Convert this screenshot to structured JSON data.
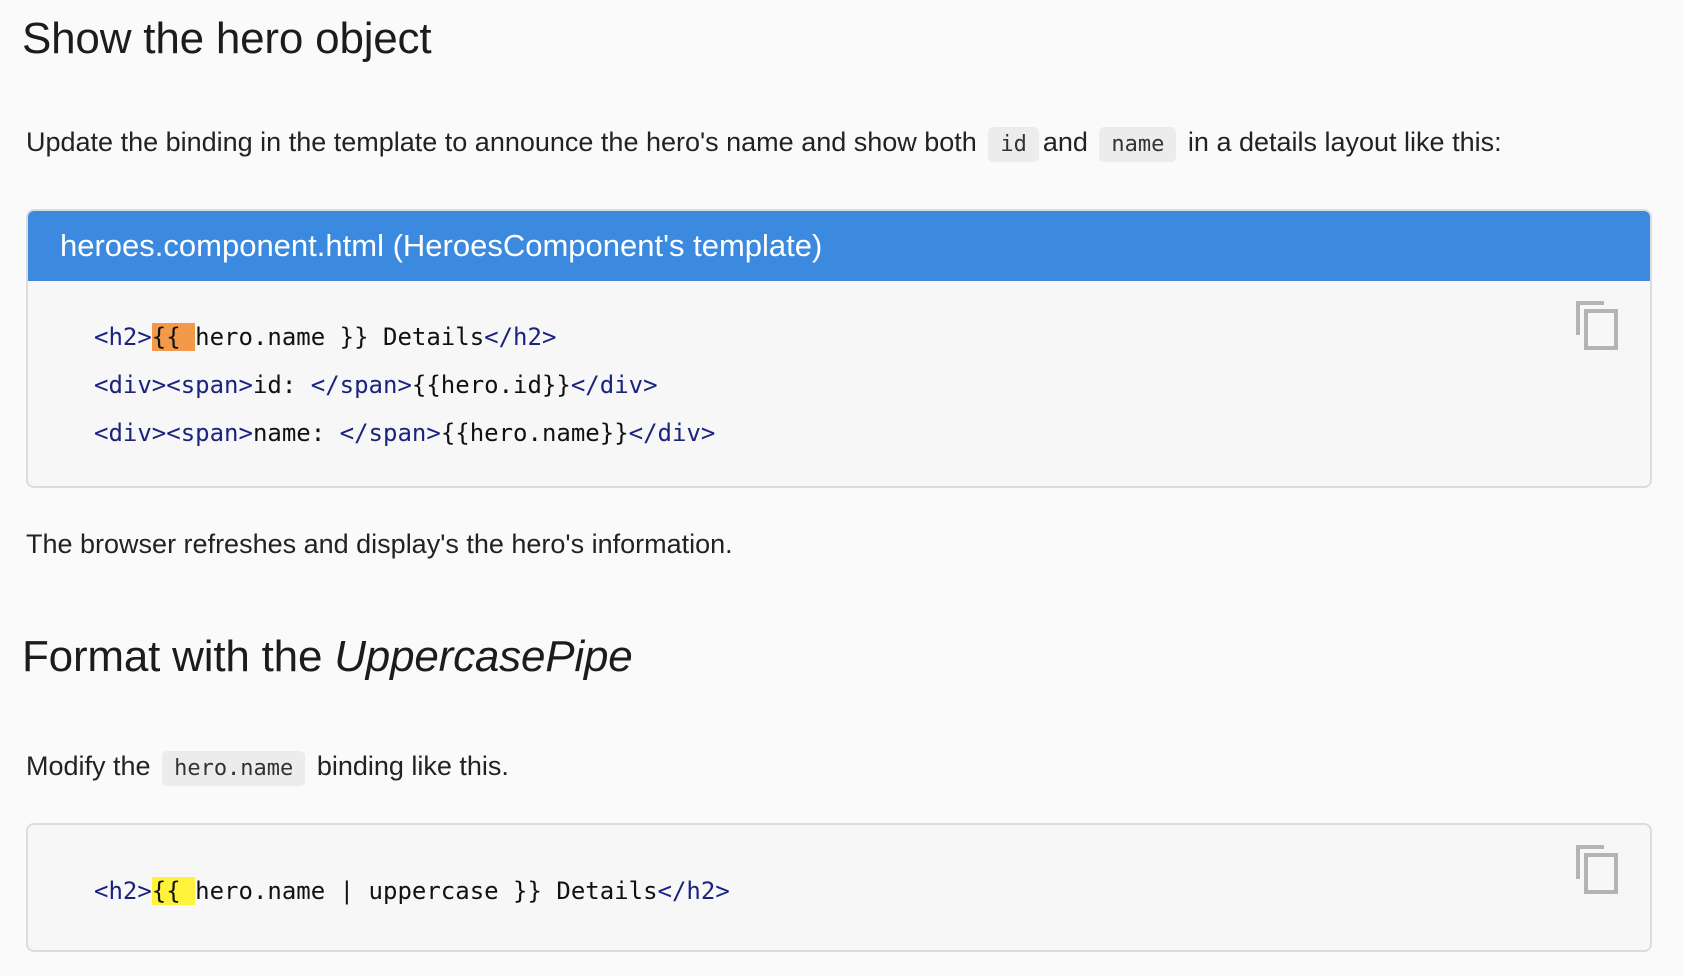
{
  "section1": {
    "title": "Show the hero object",
    "intro_pre": "Update the binding in the template to announce the hero's name and show both",
    "intro_code_id": "id",
    "intro_and": "and",
    "intro_code_name": "name",
    "intro_post": "in a details layout like this:"
  },
  "code_example_1": {
    "header": "heroes.component.html (HeroesComponent's template)",
    "lines": [
      {
        "t1": "<h2>",
        "hl": "{{ ",
        "t2": "hero.name }} Details",
        "t3": "</h2>"
      },
      {
        "t1": "<div><span>",
        "t2": "id: ",
        "t3": "</span>",
        "t4": "{{hero.id}}",
        "t5": "</div>"
      },
      {
        "t1": "<div><span>",
        "t2": "name: ",
        "t3": "</span>",
        "t4": "{{hero.name}}",
        "t5": "</div>"
      }
    ],
    "copy_icon": "copy-icon"
  },
  "section1_after": "The browser refreshes and display's the hero's information.",
  "section2": {
    "title_pre": "Format with the ",
    "title_em": "UppercasePipe",
    "modify_pre": "Modify the",
    "modify_code": "hero.name",
    "modify_post": "binding like this."
  },
  "code_example_2": {
    "line": {
      "t1": "<h2>",
      "hl": "{{ ",
      "t2": "hero.name | uppercase }} Details",
      "t3": "</h2>"
    },
    "copy_icon": "copy-icon"
  },
  "colors": {
    "header_blue": "#3c8ae0",
    "tag_navy": "#1a237e",
    "highlight_orange": "#f2994a",
    "highlight_yellow": "#fff23d"
  }
}
